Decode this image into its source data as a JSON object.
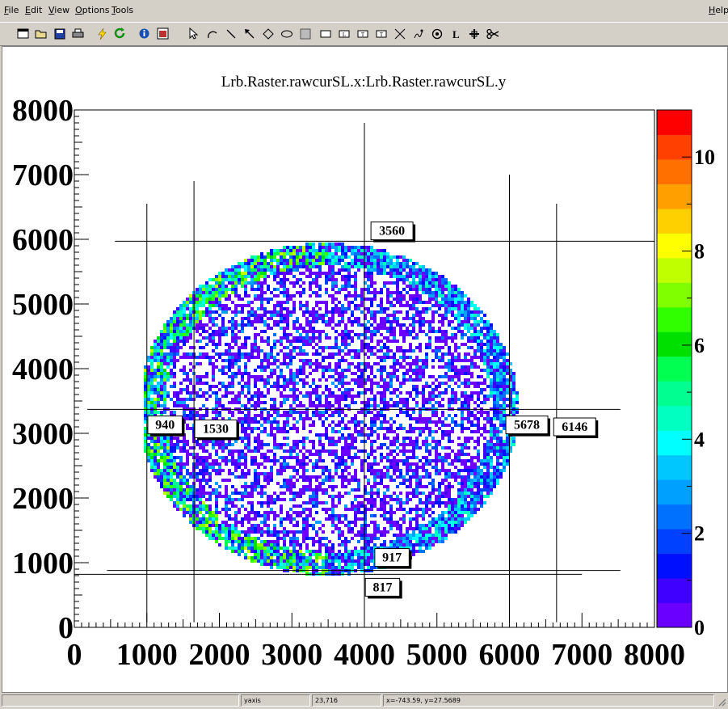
{
  "menu": {
    "file": "File",
    "edit": "Edit",
    "view": "View",
    "options": "Options",
    "tools": "Tools",
    "help": "Help"
  },
  "toolbar_icons": [
    "new-canvas-icon",
    "open-icon",
    "save-icon",
    "print-icon",
    "interrupt-icon",
    "refresh-icon",
    "inspect-icon",
    "browser-icon",
    "pointer-icon",
    "arc-icon",
    "line-icon",
    "arrow-icon",
    "diamond-icon",
    "ellipse-icon",
    "pad-icon",
    "pave-icon",
    "pave-label-icon",
    "pave-text-icon",
    "text-icon",
    "graph-icon",
    "curly-line-icon",
    "marker-icon",
    "latex-icon",
    "crosshair-icon",
    "cut-icon"
  ],
  "status": {
    "object": "yaxis",
    "position": "23,716",
    "info": "x=-743.59, y=27.5689"
  },
  "chart_data": {
    "type": "heatmap",
    "title": "Lrb.Raster.rawcurSL.x:Lrb.Raster.rawcurSL.y",
    "xlim": [
      0,
      8000
    ],
    "ylim": [
      0,
      8000
    ],
    "x_ticks": [
      "0",
      "1000",
      "2000",
      "3000",
      "4000",
      "5000",
      "6000",
      "7000",
      "8000"
    ],
    "y_ticks": [
      "0",
      "1000",
      "2000",
      "3000",
      "4000",
      "5000",
      "6000",
      "7000",
      "8000"
    ],
    "colorbar": {
      "range": [
        0,
        11
      ],
      "ticks": [
        "0",
        "2",
        "4",
        "6",
        "8",
        "10"
      ]
    },
    "palette": [
      "#6a00ff",
      "#4000ff",
      "#0010ff",
      "#0040ff",
      "#0070ff",
      "#00a0ff",
      "#00c8ff",
      "#00ffff",
      "#00ffc0",
      "#00ff90",
      "#00ff50",
      "#00e000",
      "#30ff00",
      "#80ff00",
      "#c0ff00",
      "#ffff00",
      "#ffd000",
      "#ffa000",
      "#ff7000",
      "#ff4000",
      "#ff0000"
    ],
    "ellipse": {
      "center": [
        3480,
        3400
      ],
      "rx": 2620,
      "ry": 2570
    },
    "guide_lines": {
      "vertical": [
        {
          "x": 1000,
          "y": [
            80,
            6550
          ]
        },
        {
          "x": 1650,
          "y": [
            80,
            6900
          ]
        },
        {
          "x": 4000,
          "y": [
            80,
            7800
          ]
        },
        {
          "x": 6000,
          "y": [
            80,
            7000
          ]
        },
        {
          "x": 6650,
          "y": [
            80,
            6550
          ]
        }
      ],
      "horizontal": [
        {
          "y": 5970,
          "x": [
            560,
            8000
          ]
        },
        {
          "y": 3370,
          "x": [
            180,
            7530
          ]
        },
        {
          "y": 880,
          "x": [
            450,
            7530
          ]
        },
        {
          "y": 820,
          "x": [
            0,
            7000
          ]
        }
      ]
    },
    "annotations": [
      {
        "text": "3560",
        "x": 4380,
        "y": 6130
      },
      {
        "text": "940",
        "x": 1250,
        "y": 3130
      },
      {
        "text": "1530",
        "x": 1950,
        "y": 3070
      },
      {
        "text": "5678",
        "x": 6240,
        "y": 3130
      },
      {
        "text": "6146",
        "x": 6900,
        "y": 3100
      },
      {
        "text": "917",
        "x": 4380,
        "y": 1080
      },
      {
        "text": "817",
        "x": 4250,
        "y": 620
      }
    ]
  }
}
